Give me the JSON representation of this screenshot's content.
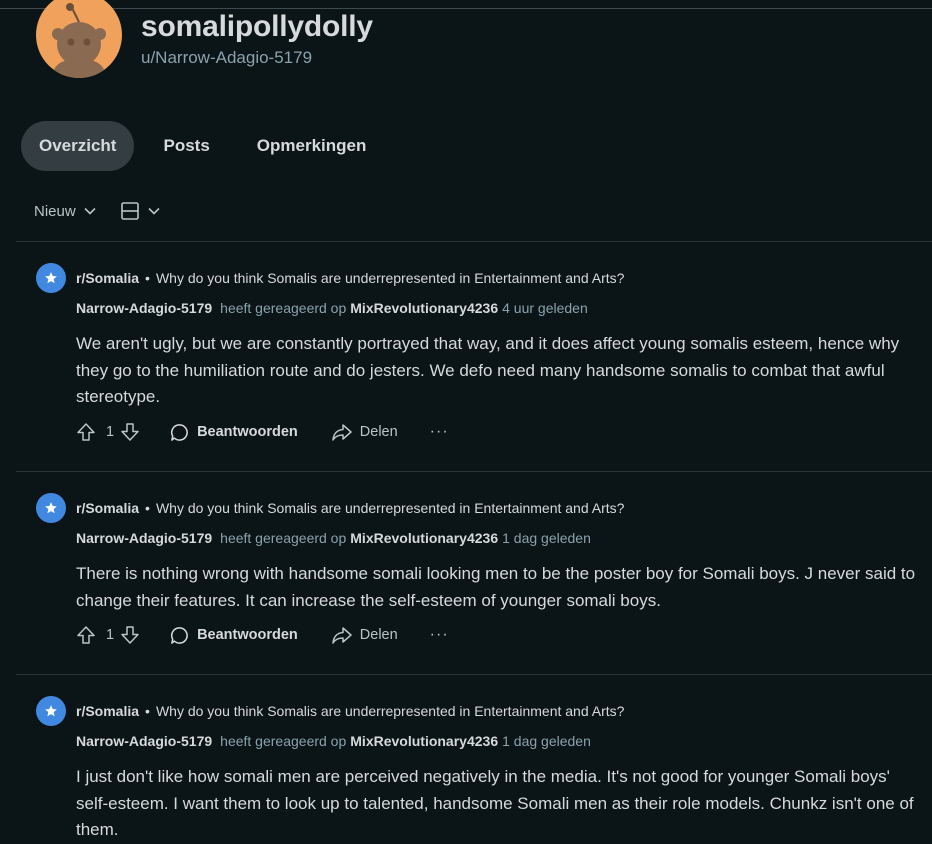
{
  "profile": {
    "display_name": "somalipollydolly",
    "handle": "u/Narrow-Adagio-5179"
  },
  "tabs": [
    {
      "label": "Overzicht",
      "active": true
    },
    {
      "label": "Posts",
      "active": false
    },
    {
      "label": "Opmerkingen",
      "active": false
    }
  ],
  "sort": {
    "label": "Nieuw"
  },
  "colors": {
    "background": "#0b1416",
    "subreddit_icon": "#4189e0",
    "avatar": "#f0a25c",
    "active_tab": "#333d42"
  },
  "comments": [
    {
      "subreddit": "r/Somalia",
      "post_title": "Why do you think Somalis are underrepresented in Entertainment and Arts?",
      "author": "Narrow-Adagio-5179",
      "action_text": "heeft gereageerd op",
      "target_user": "MixRevolutionary4236",
      "time": "4 uur geleden",
      "body": "We aren't ugly, but we are constantly portrayed that way, and it does affect young somalis esteem, hence why they go to the humiliation route and do jesters. We defo need many handsome somalis to combat that awful stereotype.",
      "votes": "1",
      "reply_label": "Beantwoorden",
      "share_label": "Delen",
      "more_label": "···"
    },
    {
      "subreddit": "r/Somalia",
      "post_title": "Why do you think Somalis are underrepresented in Entertainment and Arts?",
      "author": "Narrow-Adagio-5179",
      "action_text": "heeft gereageerd op",
      "target_user": "MixRevolutionary4236",
      "time": "1 dag geleden",
      "body": "There is nothing wrong with handsome somali looking men to be the poster boy for Somali boys. J never said to change their features. It can increase the self-esteem of younger somali boys.",
      "votes": "1",
      "reply_label": "Beantwoorden",
      "share_label": "Delen",
      "more_label": "···"
    },
    {
      "subreddit": "r/Somalia",
      "post_title": "Why do you think Somalis are underrepresented in Entertainment and Arts?",
      "author": "Narrow-Adagio-5179",
      "action_text": "heeft gereageerd op",
      "target_user": "MixRevolutionary4236",
      "time": "1 dag geleden",
      "body": "I just don't like how somali men are perceived negatively in the media. It's not good for younger Somali boys' self-esteem. I want them to look up to talented, handsome Somali men as their role models. Chunkz isn't one of them."
    }
  ]
}
